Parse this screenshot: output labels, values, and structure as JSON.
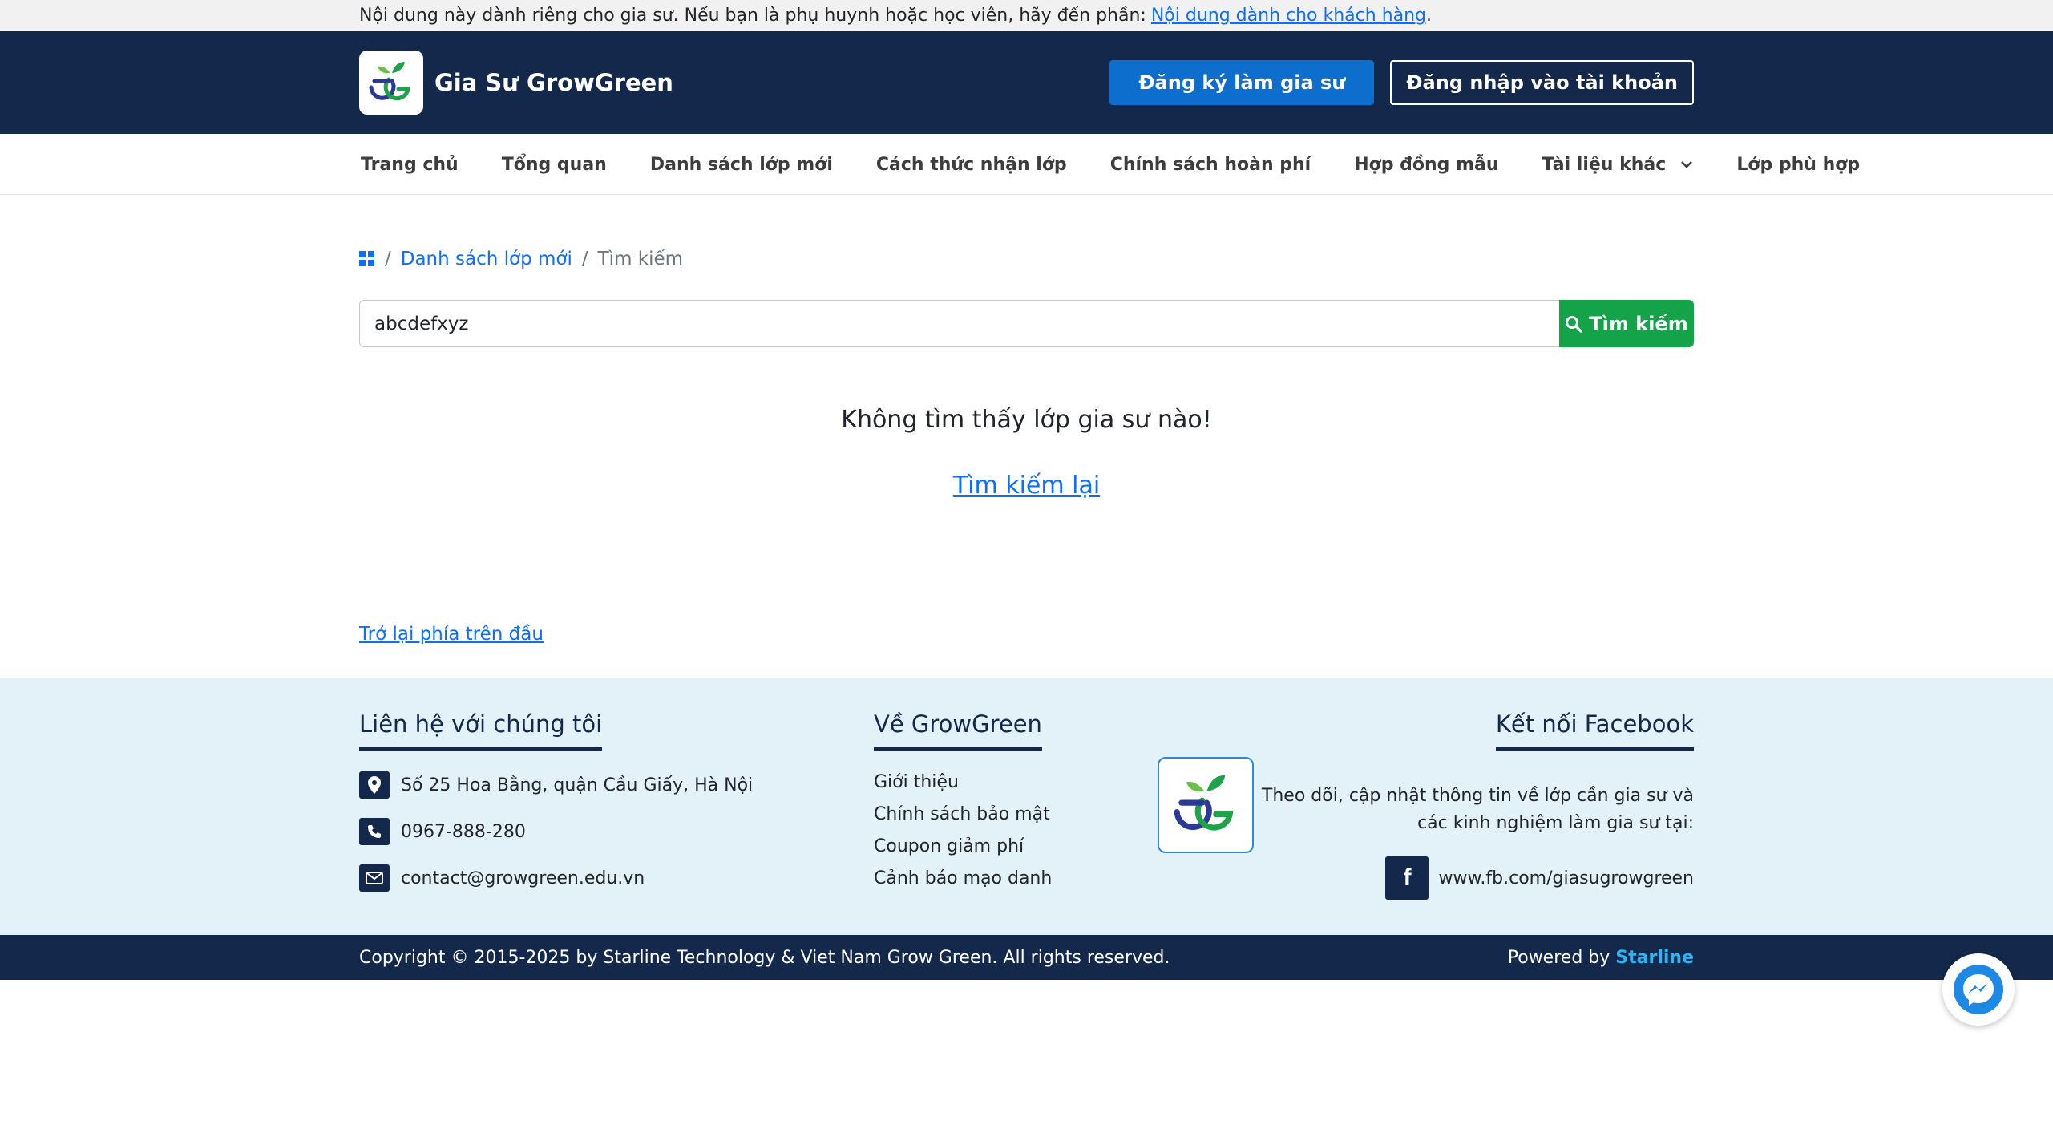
{
  "notice": {
    "text": "Nội dung này dành riêng cho gia sư. Nếu bạn là phụ huynh hoặc học viên, hãy đến phần:",
    "link": "Nội dung dành cho khách hàng",
    "trail": "."
  },
  "header": {
    "brand": "Gia Sư GrowGreen",
    "register_label": "Đăng ký làm gia sư",
    "login_label": "Đăng nhập vào tài khoản"
  },
  "nav": {
    "items": [
      "Trang chủ",
      "Tổng quan",
      "Danh sách lớp mới",
      "Cách thức nhận lớp",
      "Chính sách hoàn phí",
      "Hợp đồng mẫu",
      "Tài liệu khác",
      "Lớp phù hợp"
    ]
  },
  "breadcrumb": {
    "sep": "/",
    "link": "Danh sách lớp mới",
    "current": "Tìm kiếm"
  },
  "search": {
    "value": "abcdefxyz",
    "button_label": "Tìm kiếm"
  },
  "results": {
    "empty_message": "Không tìm thấy lớp gia sư nào!",
    "retry_label": "Tìm kiếm lại",
    "back_to_top": "Trở lại phía trên đầu"
  },
  "footer": {
    "contact_title": "Liên hệ với chúng tôi",
    "address": "Số 25 Hoa Bằng, quận Cầu Giấy, Hà Nội",
    "phone": "0967-888-280",
    "email": "contact@growgreen.edu.vn",
    "about_title": "Về GrowGreen",
    "about_links": [
      "Giới thiệu",
      "Chính sách bảo mật",
      "Coupon giảm phí",
      "Cảnh báo mạo danh"
    ],
    "fb_title": "Kết nối Facebook",
    "fb_desc": "Theo dõi, cập nhật thông tin về lớp cần gia sư và các kinh nghiệm làm gia sư tại:",
    "fb_link": "www.fb.com/giasugrowgreen"
  },
  "bottom": {
    "copyright": "Copyright © 2015-2025 by Starline Technology & Viet Nam Grow Green. All rights reserved.",
    "powered_prefix": "Powered by ",
    "powered_brand": "Starline"
  },
  "colors": {
    "navy": "#14284b",
    "primary": "#0d6ece",
    "success": "#15a34a",
    "footer_bg": "#e3f1f8",
    "notice_bg": "#f1f1f1"
  }
}
